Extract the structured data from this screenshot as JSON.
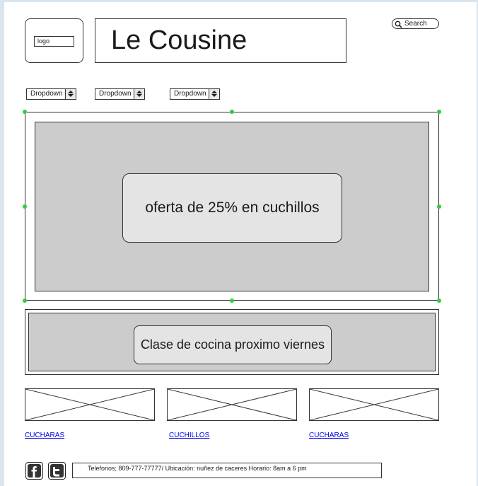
{
  "header": {
    "logo_label": "logo",
    "site_title": "Le Cousine",
    "search_label": "Search"
  },
  "nav": {
    "dropdowns": [
      {
        "label": "Dropdown"
      },
      {
        "label": "Dropdown"
      },
      {
        "label": "Dropdown"
      }
    ]
  },
  "banner": {
    "offer_text": "oferta de 25% en cuchillos"
  },
  "promo": {
    "class_text": "Clase de cocina proximo viernes"
  },
  "products": [
    {
      "label": "CUCHARAS"
    },
    {
      "label": "CUCHILLOS"
    },
    {
      "label": "CUCHARAS"
    }
  ],
  "footer": {
    "info_text": "Telefonos; 809-777-77777/ Ubicación: nuñez de caceres Horario: 8am a 6 pm",
    "social": [
      "facebook-icon",
      "twitter-icon"
    ]
  },
  "colors": {
    "placeholder_fill": "#cccccc",
    "box_fill": "#e4e4e4",
    "selection_handle": "#2ecc40",
    "link": "#0000ee"
  }
}
